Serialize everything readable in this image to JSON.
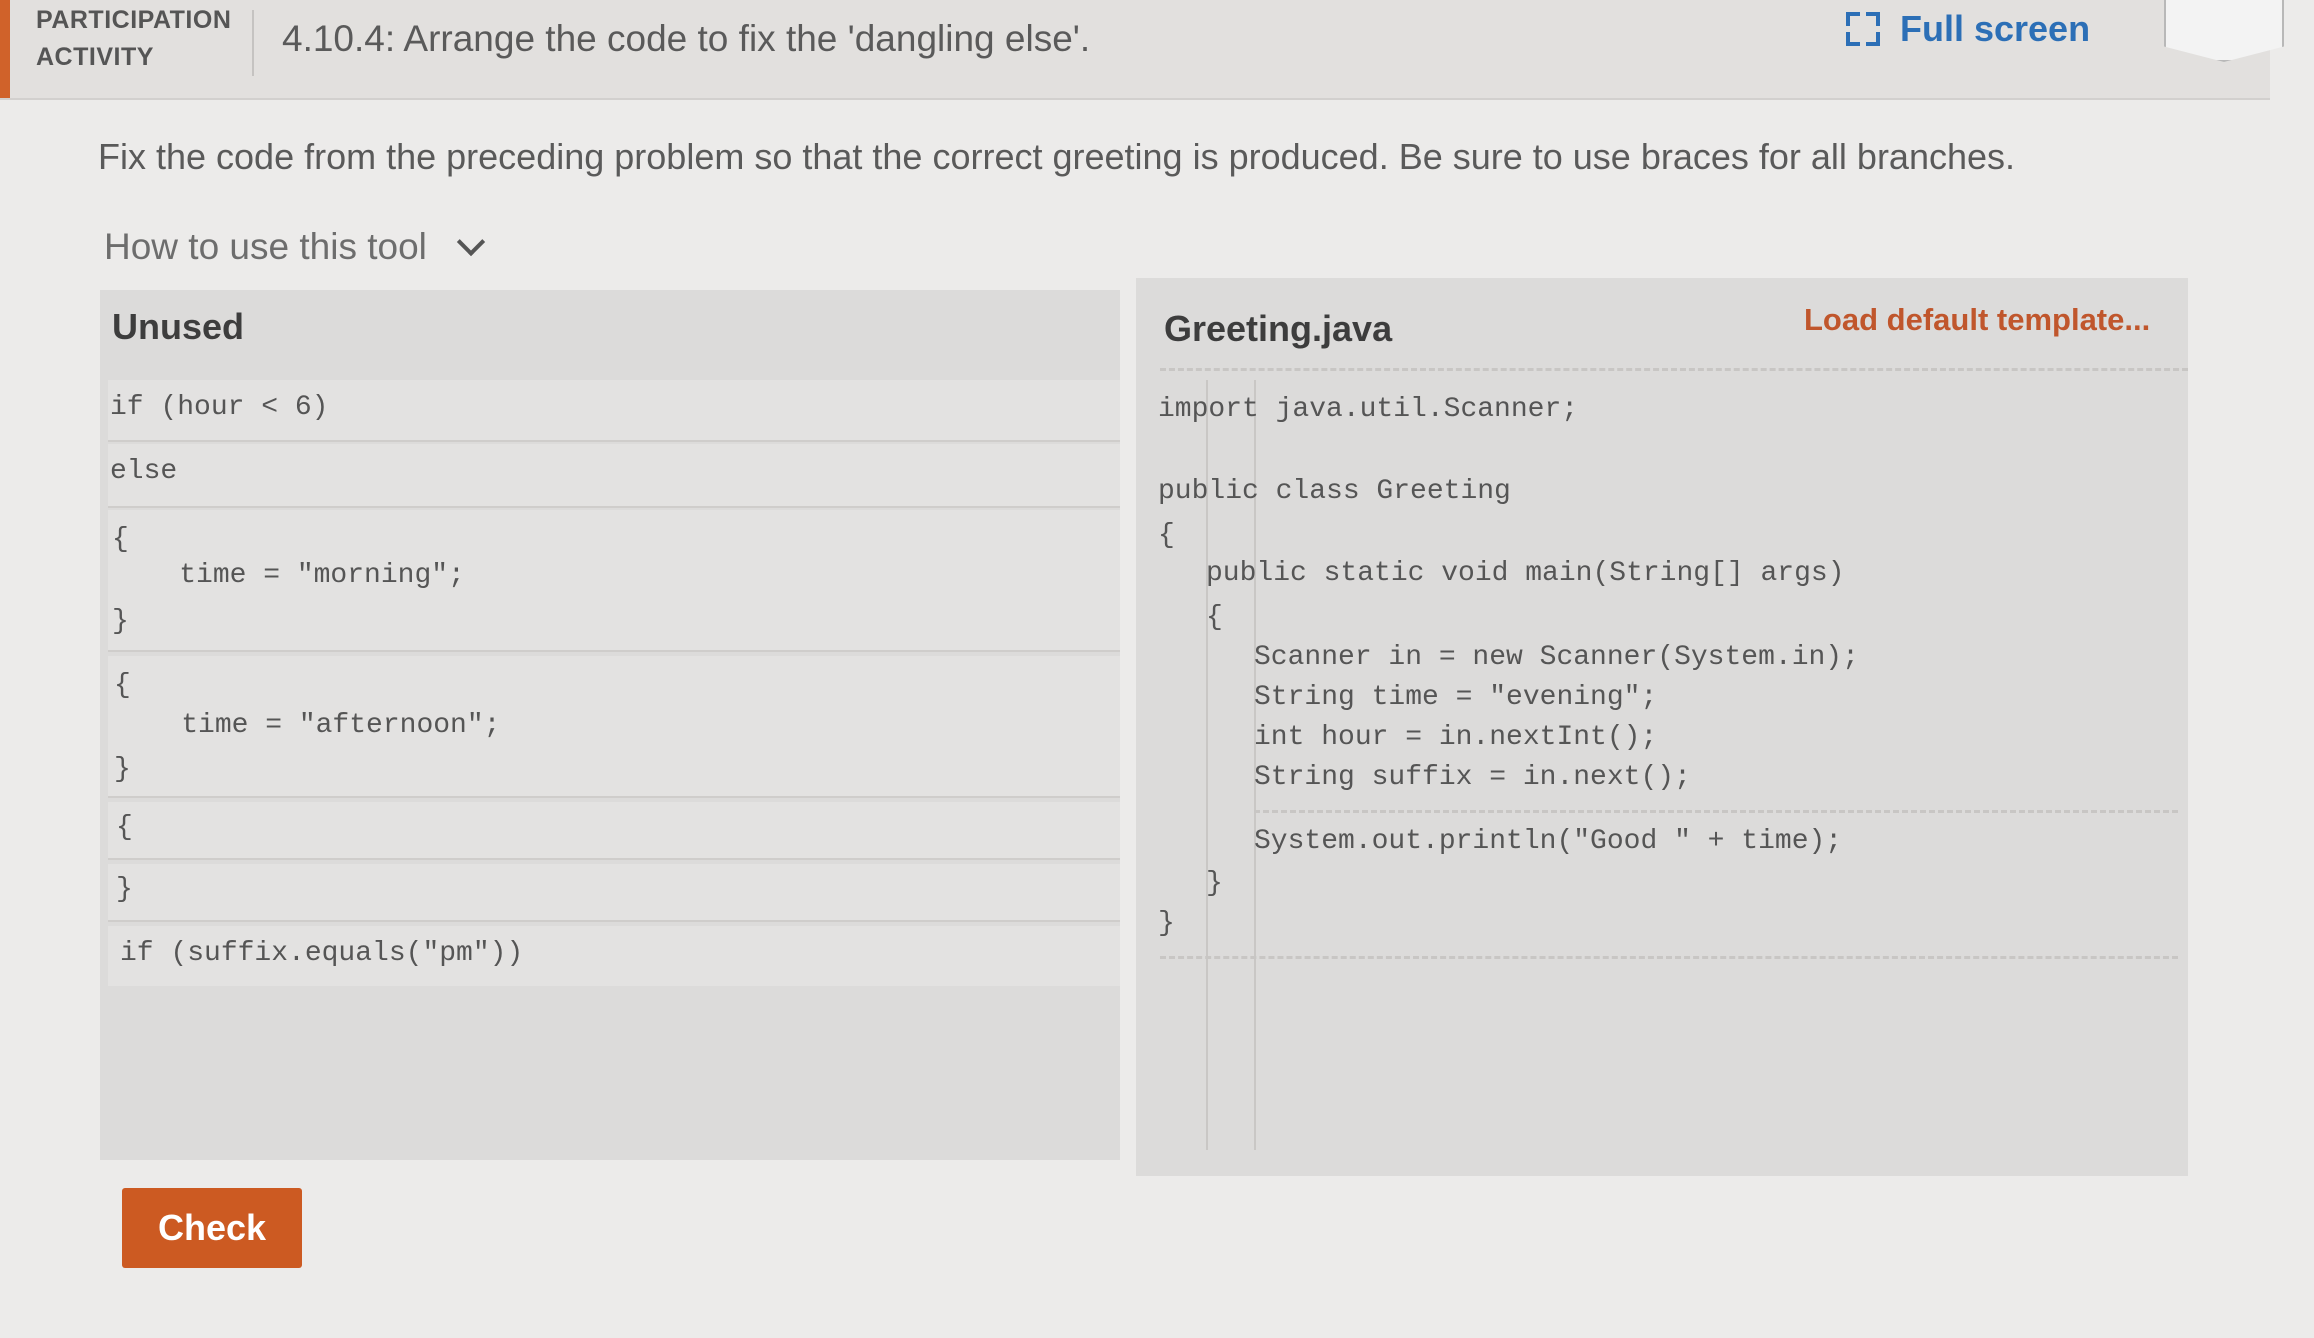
{
  "header": {
    "participation_label": "PARTICIPATION ACTIVITY",
    "title": "4.10.4: Arrange the code to fix the 'dangling else'.",
    "fullscreen_label": "Full screen"
  },
  "instructions": "Fix the code from the preceding problem so that the correct greeting is produced. Be sure to use braces for all branches.",
  "how_to_label": "How to use this tool",
  "unused": {
    "title": "Unused",
    "blocks": [
      {
        "lines": [
          "if (hour < 6)"
        ]
      },
      {
        "lines": [
          "else"
        ]
      },
      {
        "lines": [
          "{",
          "    time = \"morning\";",
          "}"
        ]
      },
      {
        "lines": [
          "{",
          "    time = \"afternoon\";",
          "}"
        ]
      },
      {
        "lines": [
          "{"
        ]
      },
      {
        "lines": [
          "}"
        ]
      },
      {
        "lines": [
          "if (suffix.equals(\"pm\"))"
        ]
      }
    ]
  },
  "editor": {
    "title": "Greeting.java",
    "load_template_label": "Load default template...",
    "lines": [
      "import java.util.Scanner;",
      "public class Greeting",
      "{",
      "public static void main(String[] args)",
      "{",
      "Scanner in = new Scanner(System.in);",
      "String time = \"evening\";",
      "int hour = in.nextInt();",
      "String suffix = in.next();",
      "System.out.println(\"Good \" + time);",
      "}",
      "}"
    ]
  },
  "check_label": "Check",
  "colors": {
    "accent": "#d0622a",
    "link_blue": "#2c6fb6",
    "check_button": "#cc5a22"
  }
}
